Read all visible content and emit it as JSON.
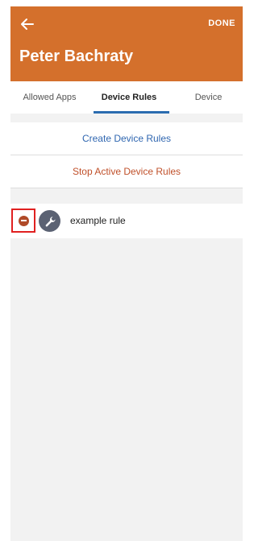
{
  "header": {
    "back_icon": "arrow-left-icon",
    "done_label": "DONE",
    "title": "Peter Bachraty",
    "color": "#d4702c"
  },
  "tabs": [
    {
      "label": "Allowed Apps"
    },
    {
      "label": "Device Rules",
      "selected": true
    },
    {
      "label": "Device"
    }
  ],
  "actions": {
    "create_label": "Create Device Rules",
    "stop_label": "Stop Active Device Rules"
  },
  "rules": [
    {
      "name": "example rule",
      "icon": "wrench-icon",
      "remove_icon": "remove-icon"
    }
  ]
}
